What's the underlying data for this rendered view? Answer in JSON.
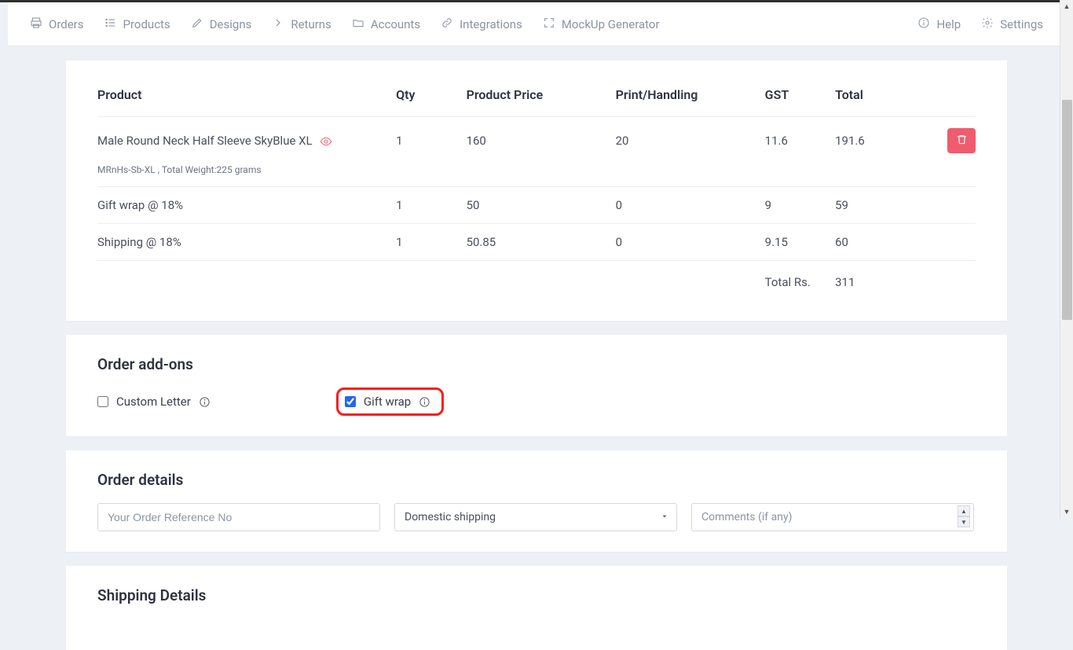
{
  "nav": {
    "left": [
      {
        "label": "Orders",
        "icon": "printer"
      },
      {
        "label": "Products",
        "icon": "list"
      },
      {
        "label": "Designs",
        "icon": "pencil"
      },
      {
        "label": "Returns",
        "icon": "chevron-right"
      },
      {
        "label": "Accounts",
        "icon": "folder"
      },
      {
        "label": "Integrations",
        "icon": "link"
      },
      {
        "label": "MockUp Generator",
        "icon": "expand"
      }
    ],
    "right": [
      {
        "label": "Help",
        "icon": "info"
      },
      {
        "label": "Settings",
        "icon": "gear"
      }
    ]
  },
  "table": {
    "headers": {
      "product": "Product",
      "qty": "Qty",
      "price": "Product Price",
      "print": "Print/Handling",
      "gst": "GST",
      "total": "Total"
    },
    "rows": [
      {
        "product": "Male Round Neck Half Sleeve SkyBlue XL",
        "meta": "MRnHs-Sb-XL , Total Weight:225 grams",
        "qty": "1",
        "price": "160",
        "print": "20",
        "gst": "11.6",
        "total": "191.6",
        "deletable": true
      },
      {
        "product": "Gift wrap @ 18%",
        "qty": "1",
        "price": "50",
        "print": "0",
        "gst": "9",
        "total": "59"
      },
      {
        "product": "Shipping @ 18%",
        "qty": "1",
        "price": "50.85",
        "print": "0",
        "gst": "9.15",
        "total": "60"
      }
    ],
    "summary": {
      "label": "Total Rs.",
      "value": "311"
    }
  },
  "addons": {
    "title": "Order add-ons",
    "custom_letter": "Custom Letter",
    "gift_wrap": "Gift wrap"
  },
  "details": {
    "title": "Order details",
    "ref_placeholder": "Your Order Reference No",
    "shipping_selected": "Domestic shipping",
    "comments_placeholder": "Comments (if any)"
  },
  "shipping": {
    "title": "Shipping Details"
  }
}
